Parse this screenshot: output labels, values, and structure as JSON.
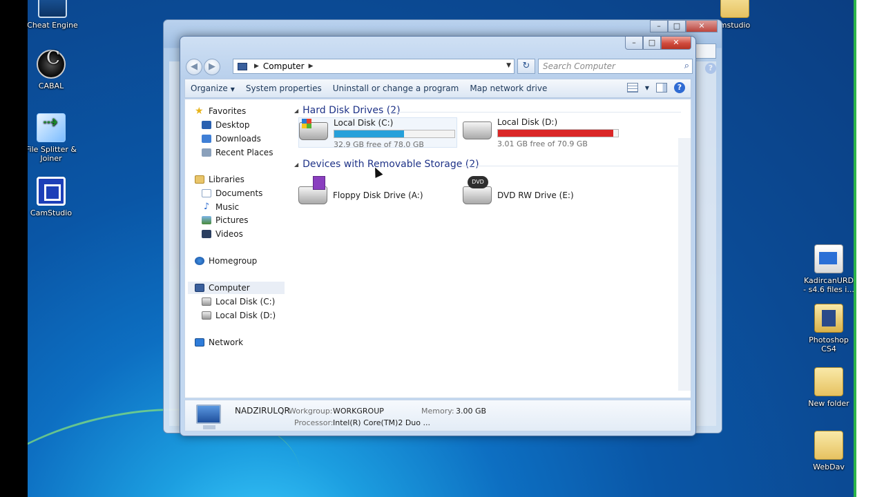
{
  "desktop": {
    "icons_left": [
      {
        "label": "Cheat Engine"
      },
      {
        "label": "CABAL"
      },
      {
        "label": "File Splitter & Joiner"
      },
      {
        "label": "CamStudio"
      }
    ],
    "icons_right": [
      {
        "label": "mstudio"
      },
      {
        "label": "KadircanURD - s4.6 files i..."
      },
      {
        "label": "Photoshop CS4"
      },
      {
        "label": "New folder"
      },
      {
        "label": "WebDav"
      }
    ]
  },
  "window": {
    "controls": {
      "minimize": "–",
      "maximize": "□",
      "close": "✕"
    },
    "nav": {
      "back": "◀",
      "forward": "▶"
    },
    "address": {
      "location": "Computer",
      "separator": "▶"
    },
    "refresh_icon": "↻",
    "search": {
      "placeholder": "Search Computer"
    },
    "toolbar": {
      "organize": "Organize",
      "system_properties": "System properties",
      "uninstall": "Uninstall or change a program",
      "map_drive": "Map network drive",
      "help": "?"
    },
    "nav_pane": {
      "favorites": "Favorites",
      "desktop": "Desktop",
      "downloads": "Downloads",
      "recent": "Recent Places",
      "libraries": "Libraries",
      "documents": "Documents",
      "music": "Music",
      "pictures": "Pictures",
      "videos": "Videos",
      "homegroup": "Homegroup",
      "computer": "Computer",
      "local_c": "Local Disk (C:)",
      "local_d": "Local Disk (D:)",
      "network": "Network"
    },
    "groups": {
      "hard_disks": "Hard Disk Drives (2)",
      "removable": "Devices with Removable Storage (2)"
    },
    "drives": {
      "c": {
        "name": "Local Disk (C:)",
        "free": "32.9 GB free of 78.0 GB",
        "used_fraction": 0.58,
        "color": "#26a0da"
      },
      "d": {
        "name": "Local Disk (D:)",
        "free": "3.01 GB free of 70.9 GB",
        "used_fraction": 0.96,
        "color": "#da2626"
      },
      "a": {
        "name": "Floppy Disk Drive (A:)"
      },
      "e": {
        "name": "DVD RW Drive (E:)"
      }
    },
    "details": {
      "computer_name": "NADZIRULQR",
      "workgroup_label": "Workgroup:",
      "workgroup": "WORKGROUP",
      "memory_label": "Memory:",
      "memory": "3.00 GB",
      "processor_label": "Processor:",
      "processor": "Intel(R) Core(TM)2 Duo ..."
    }
  }
}
